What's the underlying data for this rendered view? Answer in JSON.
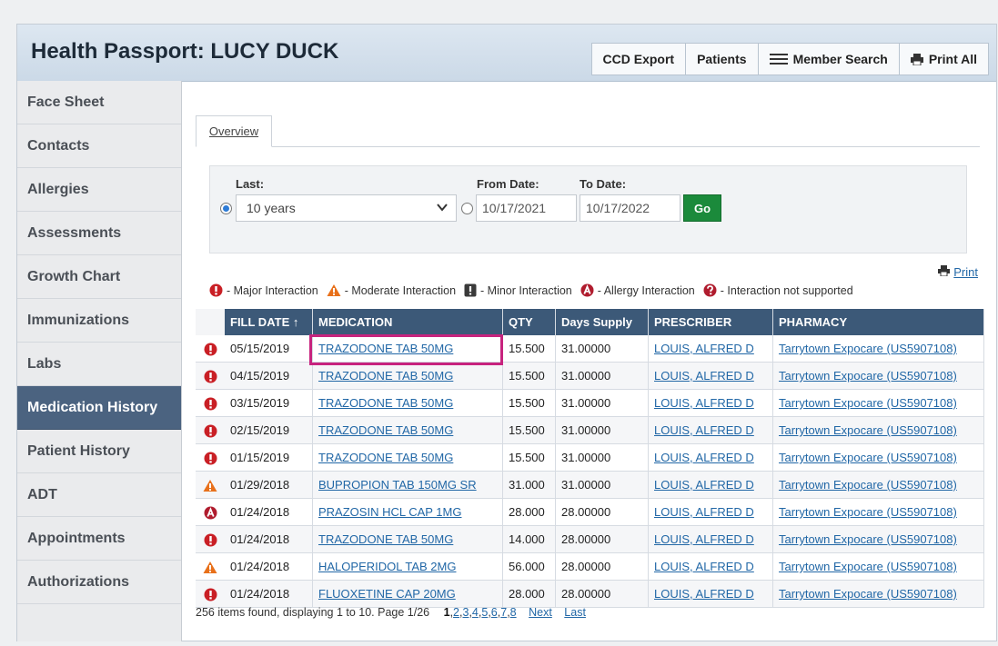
{
  "header": {
    "title": "Health Passport: LUCY DUCK",
    "buttons": {
      "ccd_export": "CCD Export",
      "patients": "Patients",
      "member_search": "Member Search",
      "print_all": "Print All"
    }
  },
  "sidebar": {
    "items": [
      {
        "label": "Face Sheet"
      },
      {
        "label": "Contacts"
      },
      {
        "label": "Allergies"
      },
      {
        "label": "Assessments"
      },
      {
        "label": "Growth Chart"
      },
      {
        "label": "Immunizations"
      },
      {
        "label": "Labs"
      },
      {
        "label": "Medication History",
        "active": true
      },
      {
        "label": "Patient History"
      },
      {
        "label": "ADT"
      },
      {
        "label": "Appointments"
      },
      {
        "label": "Authorizations"
      }
    ]
  },
  "tabs": [
    {
      "label": "Overview"
    }
  ],
  "filter": {
    "last_label": "Last:",
    "last_value": "10 years",
    "from_label": "From Date:",
    "from_value": "10/17/2021",
    "to_label": "To Date:",
    "to_value": "10/17/2022",
    "go_label": "Go"
  },
  "print_label": "Print",
  "legend": {
    "major": "- Major Interaction",
    "moderate": "- Moderate Interaction",
    "minor": "- Minor Interaction",
    "allergy": "- Allergy Interaction",
    "unsupported": "- Interaction not supported"
  },
  "table": {
    "headers": {
      "fill_date": "FILL DATE ↑",
      "medication": "MEDICATION",
      "qty": "QTY",
      "days_supply": "Days Supply",
      "prescriber": "PRESCRIBER",
      "pharmacy": "PHARMACY"
    },
    "rows": [
      {
        "icon": "major",
        "fill_date": "05/15/2019",
        "medication": "TRAZODONE TAB 50MG",
        "qty": "15.500",
        "days_supply": "31.00000",
        "prescriber": "LOUIS, ALFRED D",
        "pharmacy": "Tarrytown Expocare (US5907108)"
      },
      {
        "icon": "major",
        "fill_date": "04/15/2019",
        "medication": "TRAZODONE TAB 50MG",
        "qty": "15.500",
        "days_supply": "31.00000",
        "prescriber": "LOUIS, ALFRED D",
        "pharmacy": "Tarrytown Expocare (US5907108)"
      },
      {
        "icon": "major",
        "fill_date": "03/15/2019",
        "medication": "TRAZODONE TAB 50MG",
        "qty": "15.500",
        "days_supply": "31.00000",
        "prescriber": "LOUIS, ALFRED D",
        "pharmacy": "Tarrytown Expocare (US5907108)"
      },
      {
        "icon": "major",
        "fill_date": "02/15/2019",
        "medication": "TRAZODONE TAB 50MG",
        "qty": "15.500",
        "days_supply": "31.00000",
        "prescriber": "LOUIS, ALFRED D",
        "pharmacy": "Tarrytown Expocare (US5907108)"
      },
      {
        "icon": "major",
        "fill_date": "01/15/2019",
        "medication": "TRAZODONE TAB 50MG",
        "qty": "15.500",
        "days_supply": "31.00000",
        "prescriber": "LOUIS, ALFRED D",
        "pharmacy": "Tarrytown Expocare (US5907108)"
      },
      {
        "icon": "moderate",
        "fill_date": "01/29/2018",
        "medication": "BUPROPION TAB 150MG SR",
        "qty": "31.000",
        "days_supply": "31.00000",
        "prescriber": "LOUIS, ALFRED D",
        "pharmacy": "Tarrytown Expocare (US5907108)"
      },
      {
        "icon": "allergy",
        "fill_date": "01/24/2018",
        "medication": "PRAZOSIN HCL CAP 1MG",
        "qty": "28.000",
        "days_supply": "28.00000",
        "prescriber": "LOUIS, ALFRED D",
        "pharmacy": "Tarrytown Expocare (US5907108)"
      },
      {
        "icon": "major",
        "fill_date": "01/24/2018",
        "medication": "TRAZODONE TAB 50MG",
        "qty": "14.000",
        "days_supply": "28.00000",
        "prescriber": "LOUIS, ALFRED D",
        "pharmacy": "Tarrytown Expocare (US5907108)"
      },
      {
        "icon": "moderate",
        "fill_date": "01/24/2018",
        "medication": "HALOPERIDOL TAB 2MG",
        "qty": "56.000",
        "days_supply": "28.00000",
        "prescriber": "LOUIS, ALFRED D",
        "pharmacy": "Tarrytown Expocare (US5907108)"
      },
      {
        "icon": "major",
        "fill_date": "01/24/2018",
        "medication": "FLUOXETINE CAP 20MG",
        "qty": "28.000",
        "days_supply": "28.00000",
        "prescriber": "LOUIS, ALFRED D",
        "pharmacy": "Tarrytown Expocare (US5907108)"
      }
    ]
  },
  "pager": {
    "summary": "256 items found, displaying 1 to 10. Page 1/26",
    "current": "1",
    "pages": [
      "2",
      "3",
      "4",
      "5",
      "6",
      "7",
      "8"
    ],
    "next": "Next",
    "last": "Last"
  },
  "colors": {
    "header_row": "#3c5978",
    "active_nav": "#4b6380",
    "go_button": "#1b8a3b",
    "highlight": "#c7237e",
    "major": "#c91f25",
    "moderate": "#e8701a",
    "allergy": "#b01c2e",
    "link": "#2167a6"
  }
}
